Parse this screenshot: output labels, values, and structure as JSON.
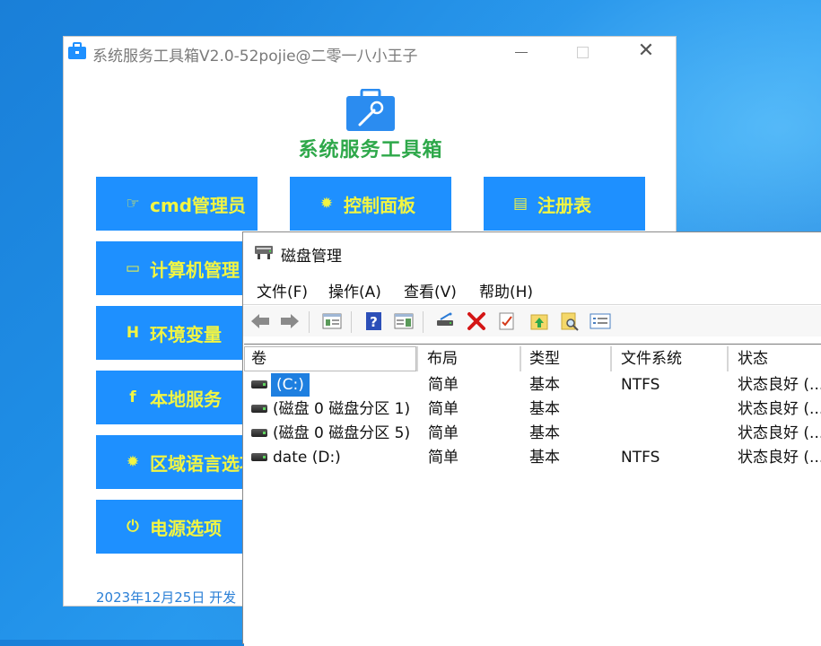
{
  "toolbox": {
    "title": "系统服务工具箱V2.0-52pojie@二零一八小王子",
    "close_glyph": "✕",
    "heading": "系统服务工具箱",
    "buttons": [
      {
        "label": "cmd管理员",
        "icon": "thumbs-up-icon",
        "glyph": "☞"
      },
      {
        "label": "控制面板",
        "icon": "gear-icon",
        "glyph": "✹"
      },
      {
        "label": "注册表",
        "icon": "registry-card-icon",
        "glyph": "▤"
      },
      {
        "label": "计算机管理",
        "icon": "monitor-icon",
        "glyph": "▭"
      },
      {
        "label": "环境变量",
        "icon": "h-letter-icon",
        "glyph": "H"
      },
      {
        "label": "本地服务",
        "icon": "facebook-f-icon",
        "glyph": "f"
      },
      {
        "label": "区域语言选项",
        "icon": "gear-icon",
        "glyph": "✹"
      },
      {
        "label": "电源选项",
        "icon": "power-icon",
        "glyph": "⏻"
      }
    ],
    "footer": "2023年12月25日 开发"
  },
  "disk_mgmt": {
    "title": "磁盘管理",
    "menu": [
      "文件(F)",
      "操作(A)",
      "查看(V)",
      "帮助(H)"
    ],
    "toolbar": [
      "back-arrow-icon",
      "forward-arrow-icon",
      "console-tree-icon",
      "help-icon",
      "action-pane-icon",
      "connect-drive-icon",
      "delete-icon",
      "checklist-icon",
      "upload-icon",
      "search-icon",
      "properties-icon"
    ],
    "columns": [
      "卷",
      "布局",
      "类型",
      "文件系统",
      "状态"
    ],
    "rows": [
      {
        "volume": "(C:)",
        "layout": "简单",
        "type": "基本",
        "fs": "NTFS",
        "status": "状态良好 (..."
      },
      {
        "volume": "(磁盘 0 磁盘分区 1)",
        "layout": "简单",
        "type": "基本",
        "fs": "",
        "status": "状态良好 (..."
      },
      {
        "volume": "(磁盘 0 磁盘分区 5)",
        "layout": "简单",
        "type": "基本",
        "fs": "",
        "status": "状态良好 (..."
      },
      {
        "volume": "date (D:)",
        "layout": "简单",
        "type": "基本",
        "fs": "NTFS",
        "status": "状态良好 (..."
      }
    ],
    "selected_row": 0
  },
  "colors": {
    "button_bg": "#1e90ff",
    "button_text": "#f2f542",
    "heading": "#2ea84a",
    "selection": "#1e7fe0"
  }
}
